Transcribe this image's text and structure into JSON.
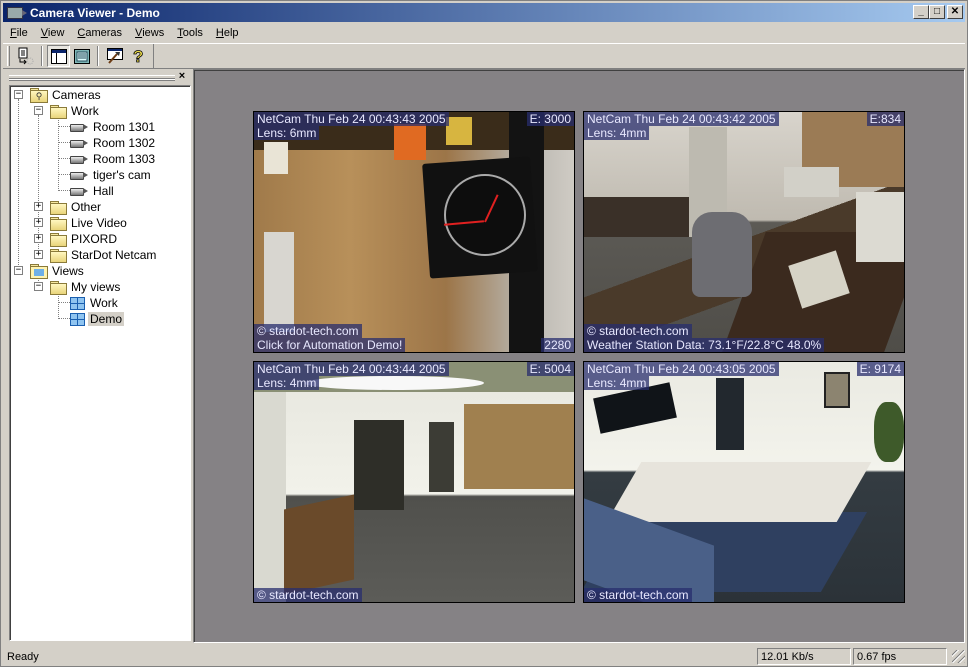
{
  "window": {
    "title": "Camera Viewer - Demo",
    "controls": {
      "minimize": "_",
      "maximize": "□",
      "close": "✕"
    }
  },
  "menu": [
    {
      "label": "File",
      "accel": "F",
      "rest": "ile"
    },
    {
      "label": "View",
      "accel": "V",
      "rest": "iew"
    },
    {
      "label": "Cameras",
      "accel": "C",
      "rest": "ameras"
    },
    {
      "label": "Views",
      "accel": "V",
      "rest": "iews"
    },
    {
      "label": "Tools",
      "accel": "T",
      "rest": "ools"
    },
    {
      "label": "Help",
      "accel": "H",
      "rest": "elp"
    }
  ],
  "toolbar": {
    "buttons": [
      {
        "name": "export-icon",
        "glyph": "🗎"
      },
      {
        "name": "tree-pane-icon",
        "pressed": true
      },
      {
        "name": "list-view-icon"
      },
      {
        "name": "properties-icon"
      },
      {
        "name": "help-icon",
        "glyph": "?"
      }
    ]
  },
  "pane": {
    "close_label": "×"
  },
  "tree": {
    "cameras": "Cameras",
    "work": "Work",
    "cams": [
      "Room 1301",
      "Room 1302",
      "Room 1303",
      "tiger's cam",
      "Hall"
    ],
    "groups": [
      "Other",
      "Live Video",
      "PIXORD",
      "StarDot Netcam"
    ],
    "views": "Views",
    "my_views": "My views",
    "view_items": [
      "Work",
      "Demo"
    ],
    "selected": "Demo",
    "expander_open": "−",
    "expander_closed": "+"
  },
  "cameras": [
    {
      "header": "NetCam Thu Feb 24 00:43:43 2005",
      "exposure": "E: 3000",
      "lens": "Lens: 6mm",
      "copyright": "© stardot-tech.com",
      "caption": "Click for Automation Demo!",
      "counter": "2280"
    },
    {
      "header": "NetCam Thu Feb 24 00:43:42 2005",
      "exposure": "E:834",
      "lens": "Lens: 4mm",
      "copyright": "© stardot-tech.com",
      "caption": "Weather Station Data: 73.1°F/22.8°C 48.0%"
    },
    {
      "header": "NetCam Thu Feb 24 00:43:44 2005",
      "exposure": "E: 5004",
      "lens": "Lens: 4mm",
      "copyright": "© stardot-tech.com"
    },
    {
      "header": "NetCam Thu Feb 24 00:43:05 2005",
      "exposure": "E: 9174",
      "lens": "Lens: 4mm",
      "copyright": "© stardot-tech.com"
    }
  ],
  "status": {
    "text": "Ready",
    "rate": "12.01 Kb/s",
    "fps": "0.67 fps"
  }
}
